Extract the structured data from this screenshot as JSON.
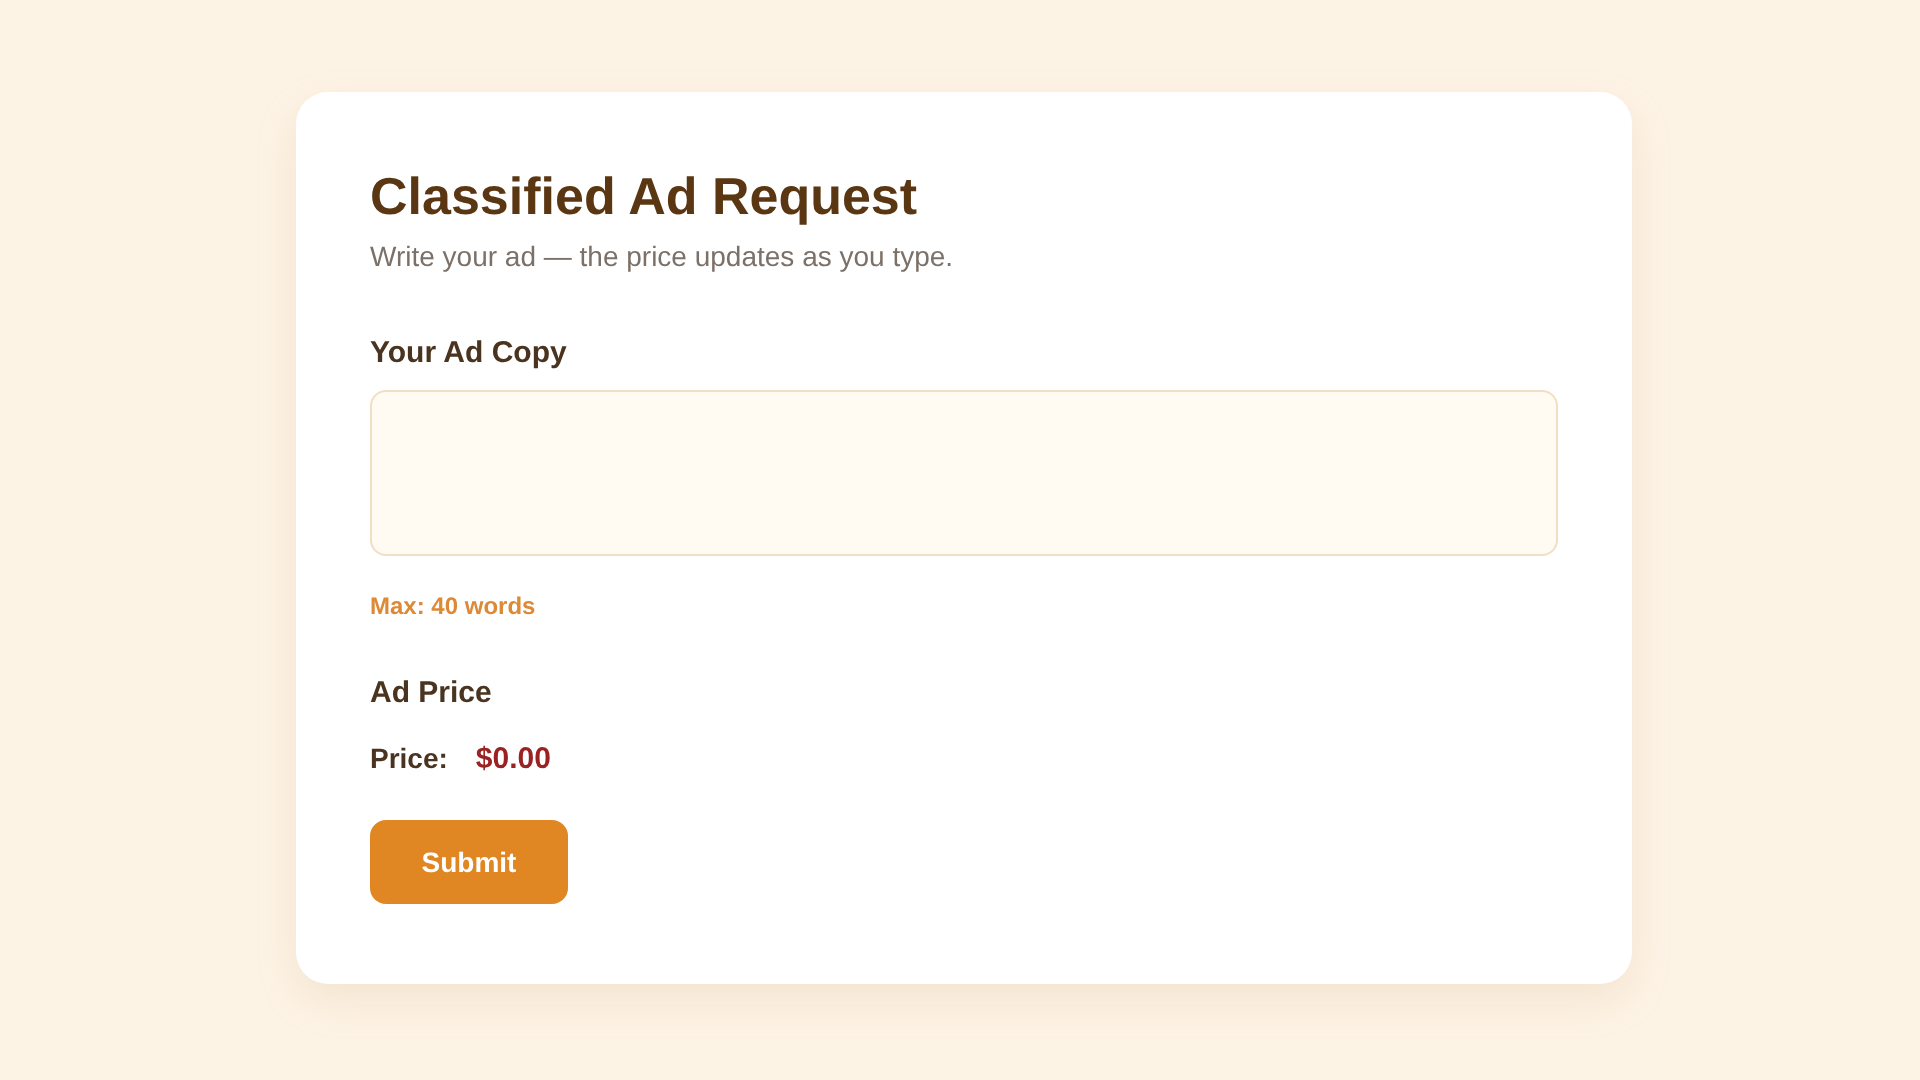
{
  "form": {
    "title": "Classified Ad Request",
    "subtitle": "Write your ad — the price updates as you type.",
    "ad_copy": {
      "label": "Your Ad Copy",
      "hint": "Max: 40 words"
    },
    "price_section": {
      "heading": "Ad Price",
      "label": "Price:",
      "value": "$0.00"
    },
    "submit": "Submit"
  }
}
